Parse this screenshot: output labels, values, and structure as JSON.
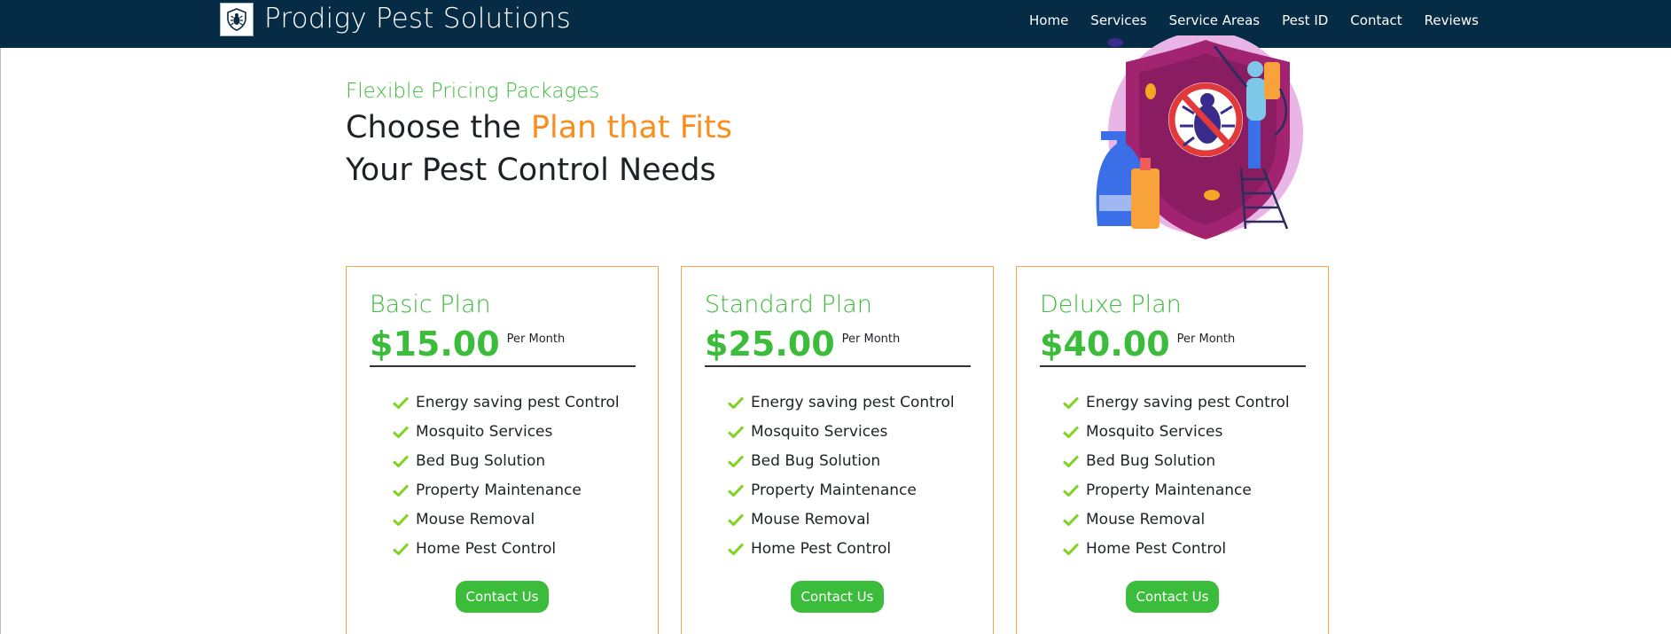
{
  "header": {
    "logo_icon": "bug-shield-icon",
    "brand": "Prodigy Pest Solutions",
    "nav": [
      "Home",
      "Services",
      "Service Areas",
      "Pest ID",
      "Contact",
      "Reviews"
    ]
  },
  "hero": {
    "eyebrow": "Flexible Pricing Packages",
    "title_part1": "Choose the ",
    "title_accent": "Plan that Fits",
    "title_line2": "Your Pest Control Needs",
    "illustration": "pest-control-shield-illustration"
  },
  "plans": [
    {
      "name": "Basic Plan",
      "price": "$15.00",
      "period": "Per Month",
      "features": [
        "Energy saving pest Control",
        "Mosquito Services",
        "Bed Bug Solution",
        "Property Maintenance",
        "Mouse Removal",
        "Home Pest Control"
      ],
      "cta": "Contact Us"
    },
    {
      "name": "Standard Plan",
      "price": "$25.00",
      "period": "Per Month",
      "features": [
        "Energy saving pest Control",
        "Mosquito Services",
        "Bed Bug Solution",
        "Property Maintenance",
        "Mouse Removal",
        "Home Pest Control"
      ],
      "cta": "Contact Us"
    },
    {
      "name": "Deluxe Plan",
      "price": "$40.00",
      "period": "Per Month",
      "features": [
        "Energy saving pest Control",
        "Mosquito Services",
        "Bed Bug Solution",
        "Property Maintenance",
        "Mouse Removal",
        "Home Pest Control"
      ],
      "cta": "Contact Us"
    }
  ],
  "colors": {
    "navbar": "#062b45",
    "green": "#3bbd3b",
    "orange": "#f78e1e",
    "card_border": "#f7a64a",
    "check": "#7fd321"
  }
}
